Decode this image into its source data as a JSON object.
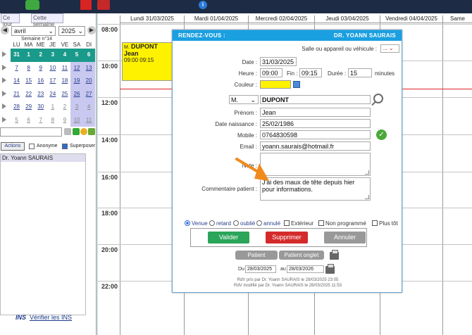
{
  "sidebar": {
    "tab_today": "Ce jour",
    "tab_week": "Cette semaine",
    "month": "avril",
    "year": "2025",
    "week_label": "Semaine n°14",
    "weekday_heads": [
      "LU",
      "MA",
      "ME",
      "JE",
      "VE",
      "SA",
      "DI"
    ],
    "calendar_rows": [
      [
        "31",
        "1",
        "2",
        "3",
        "4",
        "5",
        "6"
      ],
      [
        "7",
        "8",
        "9",
        "10",
        "11",
        "12",
        "13"
      ],
      [
        "14",
        "15",
        "16",
        "17",
        "18",
        "19",
        "20"
      ],
      [
        "21",
        "22",
        "23",
        "24",
        "25",
        "26",
        "27"
      ],
      [
        "28",
        "29",
        "30",
        "1",
        "2",
        "3",
        "4"
      ],
      [
        "5",
        "6",
        "7",
        "8",
        "9",
        "10",
        "11"
      ]
    ],
    "actions_label": "Actions",
    "anonyme_label": "Anonyme",
    "superposer_label": "Superposer",
    "doctor": "Dr. Yoann SAURAIS",
    "ins_logo": "INS",
    "ins_link": "Vérifier les INS"
  },
  "planner": {
    "days": [
      "Lundi 31/03/2025",
      "Mardi 01/04/2025",
      "Mercredi 02/04/2025",
      "Jeudi 03/04/2025",
      "Vendredi 04/04/2025",
      "Same"
    ],
    "hours": [
      "08:00",
      "10:00",
      "12:00",
      "14:00",
      "16:00",
      "18:00",
      "20:00",
      "22:00"
    ],
    "appointment": {
      "prefix": "M.",
      "name": "DUPONT Jean",
      "time": "09:00 09:15"
    }
  },
  "modal": {
    "title": "RENDEZ-VOUS :",
    "doctor": "DR. YOANN SAURAIS",
    "room_label": "Salle ou appareil ou véhicule :",
    "room_value": "...",
    "date_label": "Date :",
    "date_value": "31/03/2025",
    "heure_label": "Heure :",
    "heure_value": "09:00",
    "fin_label": "Fin :",
    "fin_value": "09:15",
    "duree_label": "Durée :",
    "duree_value": "15",
    "minutes_label": "minutes",
    "couleur_label": "Couleur :",
    "civility": "M.",
    "lastname": "DUPONT",
    "prenom_label": "Prénom :",
    "prenom_value": "Jean",
    "naissance_label": "Date naissance :",
    "naissance_value": "25/02/1986",
    "mobile_label": "Mobile :",
    "mobile_value": "0764830598",
    "email_label": "Email :",
    "email_value": "yoann.saurais@hotmail.fr",
    "note_label": "Note :",
    "comment_label": "Commentaire patient :",
    "comment_value": "J'ai des maux de tête depuis hier pour informations.",
    "status": [
      "Venue",
      "retard",
      "oublié",
      "annulé"
    ],
    "exterieur": "Extérieur",
    "non_programme": "Non programmé",
    "plus_tot": "Plus tôt",
    "valider": "Valider",
    "supprimer": "Supprimer",
    "annuler": "Annuler",
    "patient_btn": "Patient",
    "patient_onglet_btn": "Patient onglet",
    "du_label": "Du",
    "du_value": "28/03/2025",
    "au_label": "au",
    "au_value": "28/03/2026",
    "footer1": "RdV pris par Dr. Yoann SAURAIS le 28/03/2025 23:05",
    "footer2": "RdV modifié par Dr. Yoann SAURAIS le 28/03/2025 11:53"
  },
  "colors": {
    "header_blue": "#1a9fe0",
    "appt_yellow": "#fff200",
    "valider_green": "#2aa55a",
    "supprimer_red": "#d42a2a",
    "annuler_grey": "#999999",
    "annotation_arrow": "#f08a1c"
  }
}
